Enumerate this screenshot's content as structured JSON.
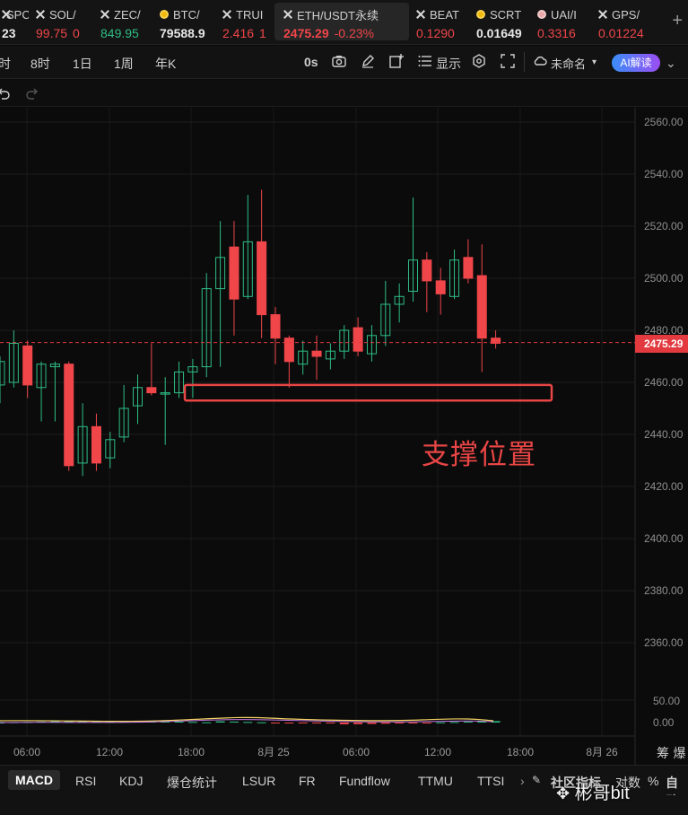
{
  "tickers": [
    {
      "name": "SPCX",
      "price": "23",
      "change": "",
      "icon": "x-icon",
      "price_color": "white"
    },
    {
      "name": "SOL/",
      "price": "99.75",
      "change": "0",
      "icon": "x-icon",
      "price_color": "down"
    },
    {
      "name": "ZEC/",
      "price": "849.95",
      "change": "",
      "icon": "x-icon",
      "price_color": "up"
    },
    {
      "name": "BTC/",
      "price": "79588.9",
      "change": "",
      "icon": "coin-icon",
      "price_color": "white"
    },
    {
      "name": "TRUI",
      "price": "2.416",
      "change": "1",
      "icon": "x-icon",
      "price_color": "down"
    },
    {
      "name": "ETH/USDT永续",
      "price": "2475.29",
      "change": "-0.23%",
      "icon": "x-icon",
      "price_color": "down",
      "active": true
    },
    {
      "name": "BEAT",
      "price": "0.1290",
      "change": "",
      "icon": "x-icon",
      "price_color": "down"
    },
    {
      "name": "SCRT",
      "price": "0.01649",
      "change": "",
      "icon": "coin-icon",
      "price_color": "white"
    },
    {
      "name": "UAI/I",
      "price": "0.3316",
      "change": "",
      "icon": "coin-pink-icon",
      "price_color": "down"
    },
    {
      "name": "GPS/",
      "price": "0.01224",
      "change": "",
      "icon": "x-icon",
      "price_color": "down"
    }
  ],
  "toolbar": {
    "timeframes": [
      "时",
      "8时",
      "1日",
      "1周",
      "年K"
    ],
    "zero_label": "0s",
    "display_label": "显示",
    "layout_name": "未命名",
    "ai_label": "AI解读"
  },
  "chart": {
    "current_price_label": "2475.29",
    "annotation": "支撑位置",
    "y_ticks": [
      "2560.00",
      "2540.00",
      "2520.00",
      "2500.00",
      "2480.00",
      "2460.00",
      "2440.00",
      "2420.00",
      "2400.00",
      "2380.00",
      "2360.00"
    ],
    "macd_ticks": [
      "50.00",
      "0.00"
    ],
    "x_ticks": [
      "06:00",
      "12:00",
      "18:00",
      "8月 25",
      "06:00",
      "12:00",
      "18:00",
      "8月 26"
    ],
    "right_label": "筹 爆"
  },
  "chart_data": {
    "type": "candlestick",
    "title": "",
    "ylim": [
      2340,
      2568
    ],
    "current_price": 2475.29,
    "support_zone": [
      2453,
      2459
    ],
    "candles": [
      {
        "o": 2459,
        "h": 2470,
        "l": 2452,
        "c": 2468
      },
      {
        "o": 2460,
        "h": 2480,
        "l": 2458,
        "c": 2475
      },
      {
        "o": 2474,
        "h": 2476,
        "l": 2454,
        "c": 2459
      },
      {
        "o": 2458,
        "h": 2468,
        "l": 2445,
        "c": 2467
      },
      {
        "o": 2466,
        "h": 2468,
        "l": 2445,
        "c": 2467
      },
      {
        "o": 2467,
        "h": 2468,
        "l": 2426,
        "c": 2428
      },
      {
        "o": 2429,
        "h": 2452,
        "l": 2424,
        "c": 2443
      },
      {
        "o": 2443,
        "h": 2448,
        "l": 2426,
        "c": 2429
      },
      {
        "o": 2431,
        "h": 2441,
        "l": 2427,
        "c": 2438
      },
      {
        "o": 2439,
        "h": 2459,
        "l": 2437,
        "c": 2450
      },
      {
        "o": 2451,
        "h": 2463,
        "l": 2444,
        "c": 2458
      },
      {
        "o": 2458,
        "h": 2475,
        "l": 2455,
        "c": 2456
      },
      {
        "o": 2456,
        "h": 2462,
        "l": 2436,
        "c": 2456
      },
      {
        "o": 2456,
        "h": 2468,
        "l": 2454,
        "c": 2464
      },
      {
        "o": 2464,
        "h": 2469,
        "l": 2454,
        "c": 2466
      },
      {
        "o": 2466,
        "h": 2502,
        "l": 2462,
        "c": 2496
      },
      {
        "o": 2496,
        "h": 2522,
        "l": 2466,
        "c": 2508
      },
      {
        "o": 2512,
        "h": 2522,
        "l": 2478,
        "c": 2492
      },
      {
        "o": 2493,
        "h": 2532,
        "l": 2492,
        "c": 2514
      },
      {
        "o": 2514,
        "h": 2534,
        "l": 2477,
        "c": 2486
      },
      {
        "o": 2486,
        "h": 2489,
        "l": 2467,
        "c": 2477
      },
      {
        "o": 2477,
        "h": 2478,
        "l": 2458,
        "c": 2468
      },
      {
        "o": 2467,
        "h": 2476,
        "l": 2463,
        "c": 2472
      },
      {
        "o": 2472,
        "h": 2478,
        "l": 2461,
        "c": 2470
      },
      {
        "o": 2469,
        "h": 2475,
        "l": 2465,
        "c": 2472
      },
      {
        "o": 2472,
        "h": 2482,
        "l": 2469,
        "c": 2480
      },
      {
        "o": 2481,
        "h": 2485,
        "l": 2470,
        "c": 2472
      },
      {
        "o": 2471,
        "h": 2482,
        "l": 2468,
        "c": 2478
      },
      {
        "o": 2478,
        "h": 2499,
        "l": 2474,
        "c": 2490
      },
      {
        "o": 2490,
        "h": 2498,
        "l": 2483,
        "c": 2493
      },
      {
        "o": 2495,
        "h": 2531,
        "l": 2491,
        "c": 2507
      },
      {
        "o": 2507,
        "h": 2510,
        "l": 2487,
        "c": 2499
      },
      {
        "o": 2499,
        "h": 2504,
        "l": 2486,
        "c": 2494
      },
      {
        "o": 2493,
        "h": 2511,
        "l": 2492,
        "c": 2507
      },
      {
        "o": 2508,
        "h": 2515,
        "l": 2498,
        "c": 2500
      },
      {
        "o": 2501,
        "h": 2513,
        "l": 2464,
        "c": 2477
      },
      {
        "o": 2477,
        "h": 2480,
        "l": 2473,
        "c": 2475
      }
    ]
  },
  "tabs": [
    "MACD",
    "RSI",
    "KDJ",
    "爆仓统计",
    "LSUR",
    "FR",
    "Fundflow",
    "TTMU",
    "TTSI"
  ],
  "tabs_right": [
    "社区指标",
    "对数",
    "%",
    "自动"
  ],
  "watermark": "彬哥bit",
  "colors": {
    "up": "#2ebd85",
    "down": "#f0464a",
    "bg": "#0b0b0b",
    "accent": "#e84545"
  }
}
